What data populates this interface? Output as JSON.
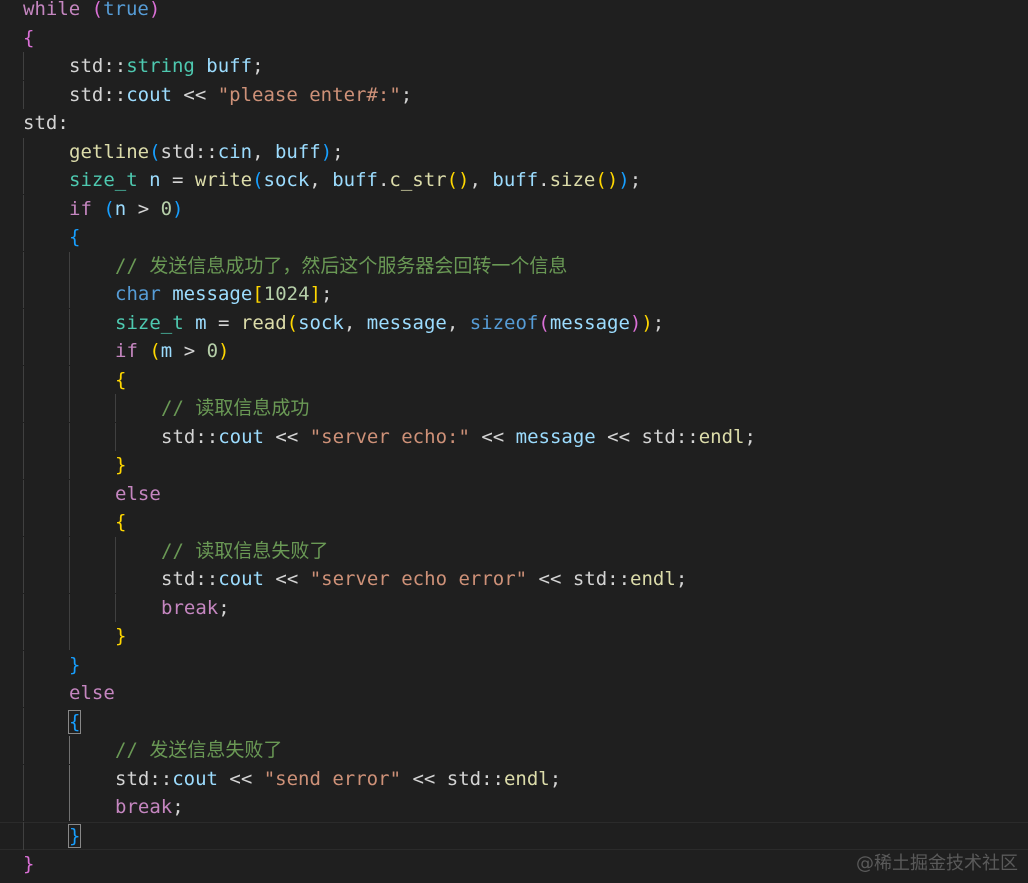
{
  "editor": {
    "lines": [
      {
        "indent": 0,
        "tokens": [
          [
            "k-ctrl",
            "while"
          ],
          [
            "op",
            " "
          ],
          [
            "b2",
            "("
          ],
          [
            "k-type",
            "true"
          ],
          [
            "b2",
            ")"
          ]
        ]
      },
      {
        "indent": 0,
        "tokens": [
          [
            "b2",
            "{"
          ]
        ]
      },
      {
        "indent": 1,
        "tokens": [
          [
            "ns",
            "std::"
          ],
          [
            "t-type",
            "string"
          ],
          [
            "op",
            " "
          ],
          [
            "var",
            "buff"
          ],
          [
            "op",
            ";"
          ]
        ]
      },
      {
        "indent": 1,
        "tokens": [
          [
            "ns",
            "std::"
          ],
          [
            "var",
            "cout"
          ],
          [
            "op",
            " << "
          ],
          [
            "str",
            "\"please enter#:\""
          ],
          [
            "op",
            ";"
          ]
        ]
      },
      {
        "indent": 0,
        "tokens": [
          [
            "ns",
            "std:"
          ]
        ]
      },
      {
        "indent": 1,
        "tokens": [
          [
            "fn",
            "getline"
          ],
          [
            "b3",
            "("
          ],
          [
            "ns",
            "std::"
          ],
          [
            "var",
            "cin"
          ],
          [
            "op",
            ", "
          ],
          [
            "var",
            "buff"
          ],
          [
            "b3",
            ")"
          ],
          [
            "op",
            ";"
          ]
        ]
      },
      {
        "indent": 1,
        "tokens": [
          [
            "t-type",
            "size_t"
          ],
          [
            "op",
            " "
          ],
          [
            "var",
            "n"
          ],
          [
            "op",
            " = "
          ],
          [
            "fn",
            "write"
          ],
          [
            "b3",
            "("
          ],
          [
            "var",
            "sock"
          ],
          [
            "op",
            ", "
          ],
          [
            "var",
            "buff"
          ],
          [
            "op",
            "."
          ],
          [
            "fn",
            "c_str"
          ],
          [
            "b1",
            "()"
          ],
          [
            "op",
            ", "
          ],
          [
            "var",
            "buff"
          ],
          [
            "op",
            "."
          ],
          [
            "fn",
            "size"
          ],
          [
            "b1",
            "()"
          ],
          [
            "b3",
            ")"
          ],
          [
            "op",
            ";"
          ]
        ]
      },
      {
        "indent": 1,
        "tokens": [
          [
            "k-ctrl",
            "if"
          ],
          [
            "op",
            " "
          ],
          [
            "b3",
            "("
          ],
          [
            "var",
            "n"
          ],
          [
            "op",
            " > "
          ],
          [
            "num",
            "0"
          ],
          [
            "b3",
            ")"
          ]
        ]
      },
      {
        "indent": 1,
        "tokens": [
          [
            "b3",
            "{"
          ]
        ]
      },
      {
        "indent": 2,
        "tokens": [
          [
            "cmt",
            "// 发送信息成功了，然后这个服务器会回转一个信息"
          ]
        ]
      },
      {
        "indent": 2,
        "tokens": [
          [
            "k-type",
            "char"
          ],
          [
            "op",
            " "
          ],
          [
            "var",
            "message"
          ],
          [
            "b1",
            "["
          ],
          [
            "num",
            "1024"
          ],
          [
            "b1",
            "]"
          ],
          [
            "op",
            ";"
          ]
        ]
      },
      {
        "indent": 2,
        "tokens": [
          [
            "t-type",
            "size_t"
          ],
          [
            "op",
            " "
          ],
          [
            "var",
            "m"
          ],
          [
            "op",
            " = "
          ],
          [
            "fn",
            "read"
          ],
          [
            "b1",
            "("
          ],
          [
            "var",
            "sock"
          ],
          [
            "op",
            ", "
          ],
          [
            "var",
            "message"
          ],
          [
            "op",
            ", "
          ],
          [
            "k-type",
            "sizeof"
          ],
          [
            "b2",
            "("
          ],
          [
            "var",
            "message"
          ],
          [
            "b2",
            ")"
          ],
          [
            "b1",
            ")"
          ],
          [
            "op",
            ";"
          ]
        ]
      },
      {
        "indent": 2,
        "tokens": [
          [
            "k-ctrl",
            "if"
          ],
          [
            "op",
            " "
          ],
          [
            "b1",
            "("
          ],
          [
            "var",
            "m"
          ],
          [
            "op",
            " > "
          ],
          [
            "num",
            "0"
          ],
          [
            "b1",
            ")"
          ]
        ]
      },
      {
        "indent": 2,
        "tokens": [
          [
            "b1",
            "{"
          ]
        ]
      },
      {
        "indent": 3,
        "tokens": [
          [
            "cmt",
            "// 读取信息成功"
          ]
        ]
      },
      {
        "indent": 3,
        "tokens": [
          [
            "ns",
            "std::"
          ],
          [
            "var",
            "cout"
          ],
          [
            "op",
            " << "
          ],
          [
            "str",
            "\"server echo:\""
          ],
          [
            "op",
            " << "
          ],
          [
            "var",
            "message"
          ],
          [
            "op",
            " << "
          ],
          [
            "ns",
            "std::"
          ],
          [
            "fn",
            "endl"
          ],
          [
            "op",
            ";"
          ]
        ]
      },
      {
        "indent": 2,
        "tokens": [
          [
            "b1",
            "}"
          ]
        ]
      },
      {
        "indent": 2,
        "tokens": [
          [
            "k-ctrl",
            "else"
          ]
        ]
      },
      {
        "indent": 2,
        "tokens": [
          [
            "b1",
            "{"
          ]
        ]
      },
      {
        "indent": 3,
        "tokens": [
          [
            "cmt",
            "// 读取信息失败了"
          ]
        ]
      },
      {
        "indent": 3,
        "tokens": [
          [
            "ns",
            "std::"
          ],
          [
            "var",
            "cout"
          ],
          [
            "op",
            " << "
          ],
          [
            "str",
            "\"server echo error\""
          ],
          [
            "op",
            " << "
          ],
          [
            "ns",
            "std::"
          ],
          [
            "fn",
            "endl"
          ],
          [
            "op",
            ";"
          ]
        ]
      },
      {
        "indent": 3,
        "tokens": [
          [
            "k-ctrl",
            "break"
          ],
          [
            "op",
            ";"
          ]
        ]
      },
      {
        "indent": 2,
        "tokens": [
          [
            "b1",
            "}"
          ]
        ]
      },
      {
        "indent": 1,
        "tokens": [
          [
            "b3",
            "}"
          ]
        ]
      },
      {
        "indent": 1,
        "tokens": [
          [
            "k-ctrl",
            "else"
          ]
        ]
      },
      {
        "indent": 1,
        "tokens": [
          [
            "b3",
            "{"
          ]
        ]
      },
      {
        "indent": 2,
        "tokens": [
          [
            "cmt",
            "// 发送信息失败了"
          ]
        ]
      },
      {
        "indent": 2,
        "tokens": [
          [
            "ns",
            "std::"
          ],
          [
            "var",
            "cout"
          ],
          [
            "op",
            " << "
          ],
          [
            "str",
            "\"send error\""
          ],
          [
            "op",
            " << "
          ],
          [
            "ns",
            "std::"
          ],
          [
            "fn",
            "endl"
          ],
          [
            "op",
            ";"
          ]
        ]
      },
      {
        "indent": 2,
        "tokens": [
          [
            "k-ctrl",
            "break"
          ],
          [
            "op",
            ";"
          ]
        ]
      },
      {
        "indent": 1,
        "tokens": [
          [
            "b3",
            "}"
          ]
        ]
      },
      {
        "indent": 0,
        "tokens": [
          [
            "b2",
            "}"
          ]
        ]
      }
    ]
  },
  "watermark": "@稀土掘金技术社区"
}
